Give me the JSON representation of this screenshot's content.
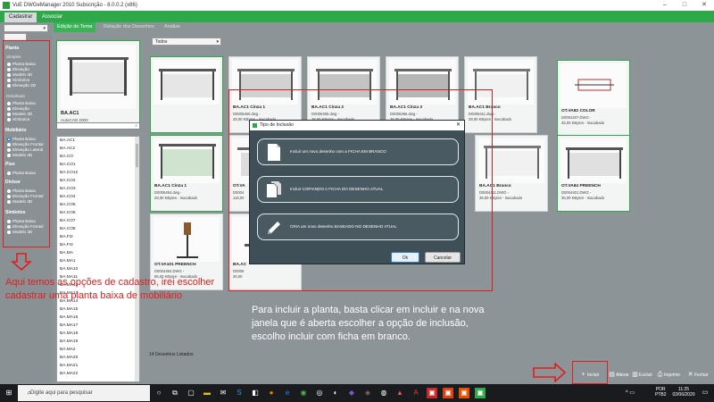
{
  "window": {
    "title": "VuE DWGeManager 2010 Subscrição - 8.0.0.2 (x86)"
  },
  "top_tabs": [
    {
      "label": "Cadastrar",
      "active": true
    },
    {
      "label": "Associar",
      "active": false
    }
  ],
  "subtabs": [
    {
      "label": "Edição do Tema",
      "active": true
    },
    {
      "label": "Relação dos Desenhos",
      "active": false
    },
    {
      "label": "Análise",
      "active": false
    }
  ],
  "options": {
    "group_planta": "Planta",
    "sub_simples": "Simples",
    "simples": [
      "Planta Baixa",
      "Elevação",
      "Modelo 3D",
      "Símbolos",
      "Elevação 3D"
    ],
    "sub_detalhado": "Detalhado",
    "detalhado": [
      "Planta Baixa",
      "Elevação",
      "Modelo 3D",
      "Símbolos"
    ],
    "group_mobiliario": "Mobiliário",
    "mobiliario": [
      "Planta Baixa",
      "Elevação Frontal",
      "Elevação Lateral",
      "Modelo 3D"
    ],
    "group_piso": "Piso",
    "piso": [
      "Planta Baixa"
    ],
    "group_divisor": "Divisor",
    "divisor": [
      "Planta Baixa",
      "Elevação Frontal",
      "Modelo 3D"
    ],
    "group_simbolos": "Símbolos",
    "simbolos": [
      "Planta Baixa",
      "Elevação Frontal",
      "Modelo 3D"
    ]
  },
  "preview": {
    "name": "BA.AC1",
    "sub": "AutoCAD 2000"
  },
  "filter": {
    "value": "Todos"
  },
  "codes": [
    "BA.AC1",
    "BA.AC2",
    "BA.CO",
    "BA.CO1",
    "BA.CO12",
    "BA.CO2",
    "BA.CO3",
    "BA.CO4",
    "BA.CO5",
    "BA.CO6",
    "BA.CO7",
    "BA.CO8",
    "BA.FI2",
    "BA.FI3",
    "BA.MA",
    "BA.MA1",
    "BA.MA10",
    "BA.MA11",
    "BA.MA12",
    "BA.MA13",
    "BA.MA14",
    "BA.MA15",
    "BA.MA16",
    "BA.MA17",
    "BA.MA18",
    "BA.MA19",
    "BA.MA2",
    "BA.MA20",
    "BA.MA21",
    "BA.MA22"
  ],
  "cards": [
    {
      "name": "",
      "f1": "",
      "f2": ""
    },
    {
      "name": "BA.AC1 Cinza 1",
      "f1": "D0006460.dwg -",
      "f2": "28,00 KBytes - Inacabado"
    },
    {
      "name": "BA.AC1 Cinza 2",
      "f1": "D0006365.dwg -",
      "f2": "28,00 KBytes - Inacabado"
    },
    {
      "name": "BA.AC1 Cinza 3",
      "f1": "D0006366.dwg -",
      "f2": "28,00 KBytes - Inacabado"
    },
    {
      "name": "BA.AC1 Branco",
      "f1": "D0006411.dwg -",
      "f2": "28,00 KBytes - Inacabado"
    },
    {
      "name": "OT.VA82 COLOR",
      "f1": "D0004407.DWG -",
      "f2": "45,00 KBytes - Inacabado"
    },
    {
      "name": "BA.AC1 Cinza 1",
      "f1": "D0006454.dwg -",
      "f2": "28,00 KBytes - Inacabado"
    },
    {
      "name": "OT.VA",
      "f1": "D0004",
      "f2": "116,00"
    },
    {
      "name": "BA.AC1 Branco",
      "f1": "D0004411.DWG -",
      "f2": "36,00 KBytes - Inacabado"
    },
    {
      "name": "OT.VA84 PREENCH",
      "f1": "D0004401.DWG -",
      "f2": "36,00 KBytes - Inacabado"
    },
    {
      "name": "OT.VA101 PREENCH",
      "f1": "D0004464.DWG -",
      "f2": "86,00 KBytes - Inacabado"
    },
    {
      "name": "BA.AC",
      "f1": "D0006",
      "f2": "26,00"
    }
  ],
  "count_label": "14 Desenhos Listados",
  "dialog": {
    "title": "Tipo de Inclusão",
    "opt1": "Incluir um novo desenho com a FICHA EM BRANCO",
    "opt2": "Incluir COPIANDO A FICHA DO DESENHO ATUAL",
    "opt3": "CRIA um novo desenho BASEADO NO DESENHO ATUAL",
    "ok": "Ok",
    "cancel": "Cancelar"
  },
  "annotations": {
    "left": "Aqui temos as opções de cadastro, irei escolher cadastrar uma planta baixa de mobiliário",
    "right": "Para incluir a planta, basta clicar em incluir e na nova janela que é aberta escolher a opção de inclusão, escolho incluir com ficha em branco."
  },
  "actions": {
    "incluir": "Incluir",
    "alterar": "Alterar",
    "excluir": "Excluir",
    "imprime": "Imprime",
    "fechar": "Fechar"
  },
  "taskbar": {
    "search_placeholder": "Digite aqui para pesquisar",
    "lang": "POR",
    "layout": "PTB2",
    "time": "11:25",
    "date": "02/06/2020"
  },
  "colors": {
    "accent_green": "#2fa84a",
    "annotation_red": "#e31b1b",
    "dialog_bg": "#3f4f58"
  }
}
